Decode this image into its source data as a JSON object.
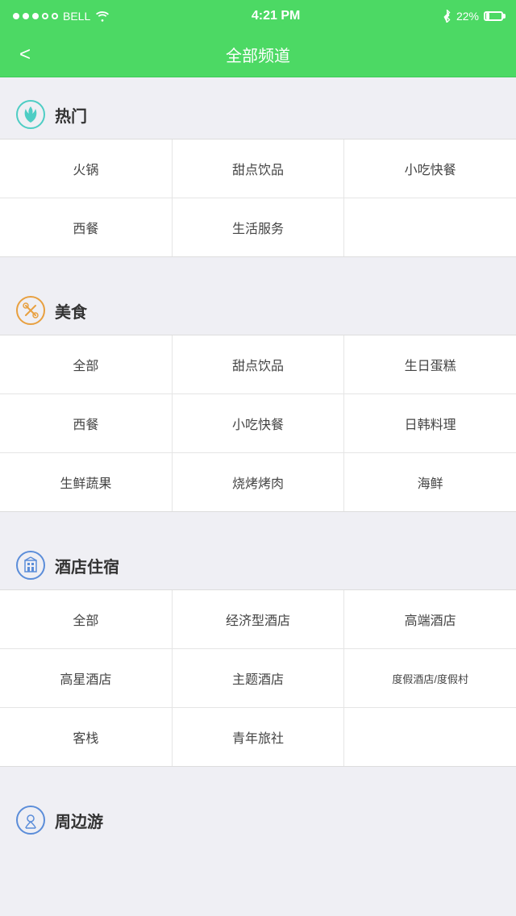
{
  "statusBar": {
    "carrier": "BELL",
    "time": "4:21 PM",
    "battery": "22%"
  },
  "header": {
    "title": "全部频道",
    "backLabel": "<"
  },
  "sections": [
    {
      "id": "hot",
      "icon": "fire-icon",
      "title": "热门",
      "rows": [
        [
          "火锅",
          "甜点饮品",
          "小吃快餐"
        ],
        [
          "西餐",
          "生活服务",
          ""
        ]
      ]
    },
    {
      "id": "food",
      "icon": "food-icon",
      "title": "美食",
      "rows": [
        [
          "全部",
          "甜点饮品",
          "生日蛋糕"
        ],
        [
          "西餐",
          "小吃快餐",
          "日韩料理"
        ],
        [
          "生鲜蔬果",
          "烧烤烤肉",
          "海鲜"
        ]
      ]
    },
    {
      "id": "hotel",
      "icon": "hotel-icon",
      "title": "酒店住宿",
      "rows": [
        [
          "全部",
          "经济型酒店",
          "高端酒店"
        ],
        [
          "高星酒店",
          "主题酒店",
          "度假酒店/度假村"
        ],
        [
          "客栈",
          "青年旅社",
          ""
        ]
      ]
    },
    {
      "id": "nearby",
      "icon": "nearby-icon",
      "title": "周边游",
      "rows": []
    }
  ]
}
